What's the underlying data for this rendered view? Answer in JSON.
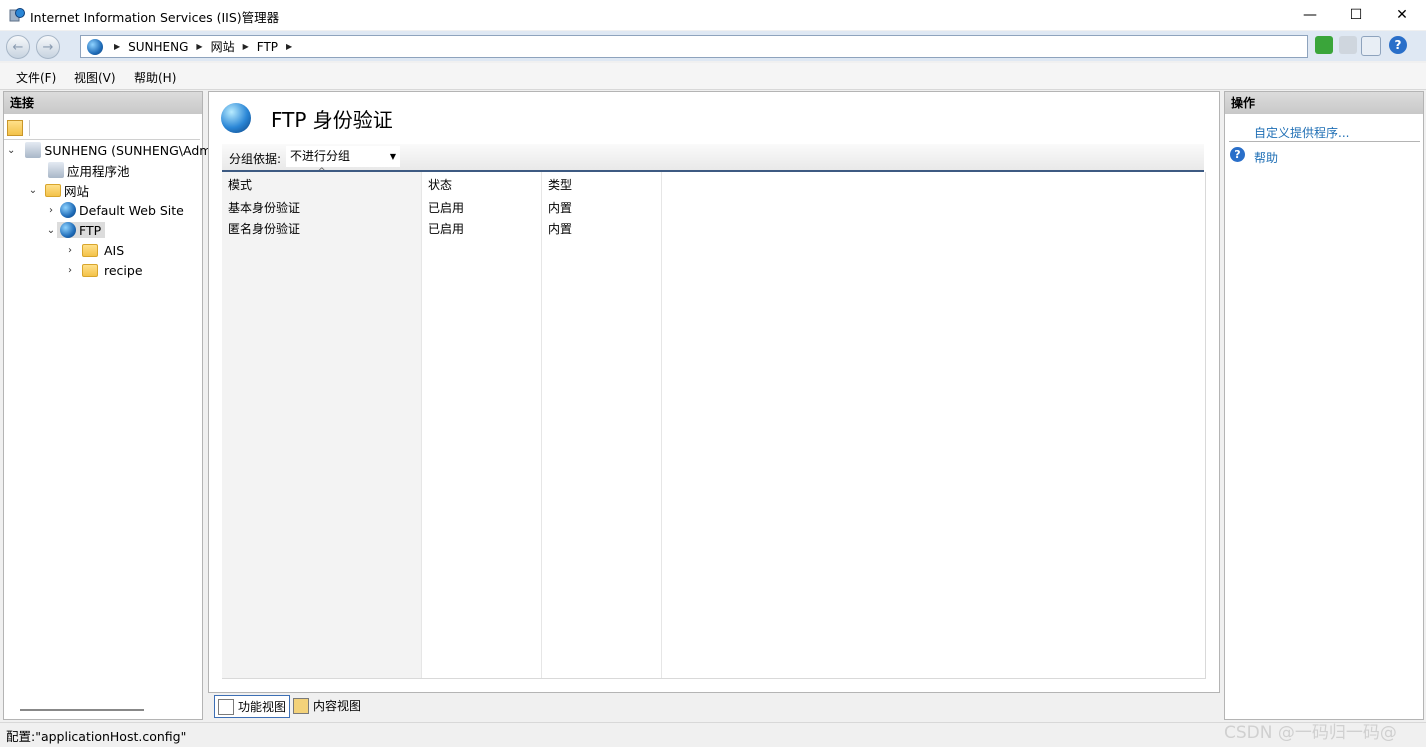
{
  "window": {
    "title": "Internet Information Services (IIS)管理器",
    "minimize": "—",
    "maximize": "☐",
    "close": "✕"
  },
  "nav": {
    "breadcrumb": [
      "SUNHENG",
      "网站",
      "FTP"
    ]
  },
  "menu": {
    "items": [
      "文件(F)",
      "视图(V)",
      "帮助(H)"
    ]
  },
  "connections": {
    "title": "连接",
    "tree": [
      {
        "label": "SUNHENG (SUNHENG\\Adm",
        "icon": "server-icon",
        "expanded": true
      },
      {
        "label": "应用程序池",
        "icon": "app-pool-icon"
      },
      {
        "label": "网站",
        "icon": "sites-icon",
        "expanded": true
      },
      {
        "label": "Default Web Site",
        "icon": "globe-icon",
        "expanded": false
      },
      {
        "label": "FTP",
        "icon": "globe-icon",
        "expanded": true,
        "selected": true
      },
      {
        "label": "AIS",
        "icon": "folder-icon",
        "expanded": false
      },
      {
        "label": "recipe",
        "icon": "folder-icon",
        "expanded": false
      }
    ]
  },
  "main": {
    "title": "FTP 身份验证",
    "group_by_label": "分组依据:",
    "group_by_value": "不进行分组",
    "columns": [
      "模式",
      "状态",
      "类型"
    ],
    "rows": [
      [
        "基本身份验证",
        "已启用",
        "内置"
      ],
      [
        "匿名身份验证",
        "已启用",
        "内置"
      ]
    ]
  },
  "view_tabs": {
    "features": "功能视图",
    "content": "内容视图"
  },
  "actions": {
    "title": "操作",
    "items": [
      {
        "label": "自定义提供程序...",
        "icon": ""
      },
      {
        "label": "帮助",
        "icon": "help-icon"
      }
    ]
  },
  "status": {
    "text": "配置:\"applicationHost.config\""
  },
  "watermark": "CSDN @一码归一码@",
  "colors": {
    "link": "#1f6fb5",
    "selection": "#cce8ff",
    "panel_header": "#c8c8c8"
  }
}
